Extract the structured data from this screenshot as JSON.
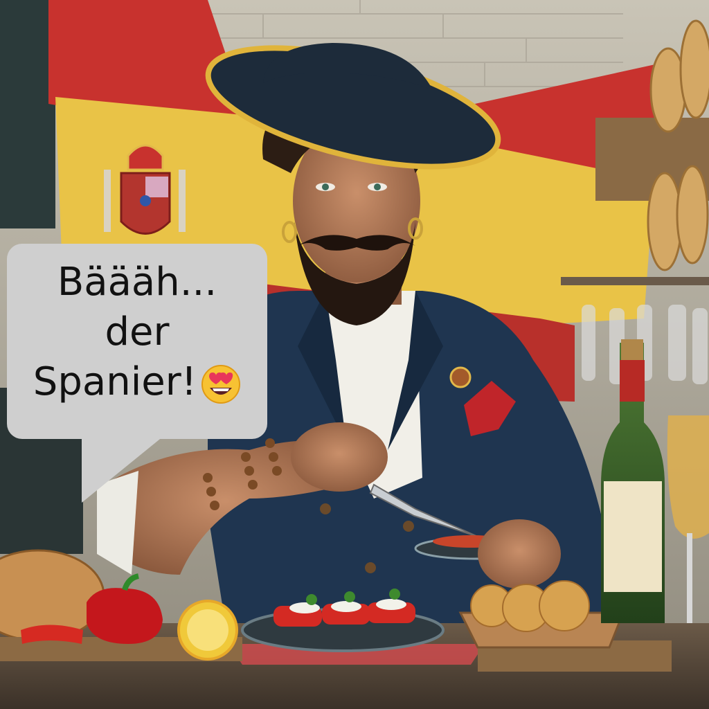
{
  "speech_bubble": {
    "line1": "Bäääh...",
    "line2": "der",
    "line3": "Spanier!",
    "emoji": "smiling-face-with-heart-eyes"
  },
  "colors": {
    "flag_red": "#c8322e",
    "flag_yellow": "#e9c347",
    "jacket_navy": "#1f3550",
    "bubble_gray": "#cfcfcf"
  }
}
